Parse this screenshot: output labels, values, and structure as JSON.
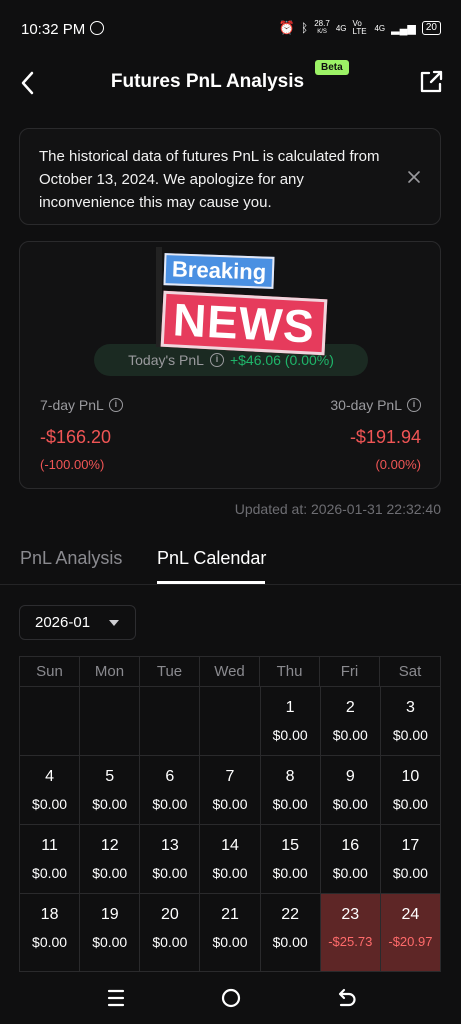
{
  "status": {
    "time": "10:32 PM",
    "speed": "28.7",
    "speed_unit": "K/S",
    "network1": "4G",
    "volte": "Vo LTE",
    "network2": "4G",
    "battery": "20"
  },
  "header": {
    "title": "Futures PnL Analysis",
    "badge": "Beta"
  },
  "notice": {
    "text": "The historical data of futures PnL is calculated from October 13, 2024. We apologize for any inconvenience this may cause you."
  },
  "overlay": {
    "breaking": "Breaking",
    "news": "NEWS"
  },
  "summary": {
    "today_label": "Today's PnL",
    "today_value": "+$46.06 (0.00%)",
    "week_label": "7-day PnL",
    "week_value": "-$166.20",
    "week_pct": "(-100.00%)",
    "month_label": "30-day PnL",
    "month_value": "-$191.94",
    "month_pct": "(0.00%)"
  },
  "updated": "Updated at: 2026-01-31 22:32:40",
  "tabs": {
    "analysis": "PnL Analysis",
    "calendar": "PnL Calendar"
  },
  "month_select": {
    "value": "2026-01"
  },
  "calendar": {
    "weekdays": [
      "Sun",
      "Mon",
      "Tue",
      "Wed",
      "Thu",
      "Fri",
      "Sat"
    ],
    "weeks": [
      [
        null,
        null,
        null,
        null,
        {
          "day": "1",
          "pnl": "$0.00"
        },
        {
          "day": "2",
          "pnl": "$0.00"
        },
        {
          "day": "3",
          "pnl": "$0.00"
        }
      ],
      [
        {
          "day": "4",
          "pnl": "$0.00"
        },
        {
          "day": "5",
          "pnl": "$0.00"
        },
        {
          "day": "6",
          "pnl": "$0.00"
        },
        {
          "day": "7",
          "pnl": "$0.00"
        },
        {
          "day": "8",
          "pnl": "$0.00"
        },
        {
          "day": "9",
          "pnl": "$0.00"
        },
        {
          "day": "10",
          "pnl": "$0.00"
        }
      ],
      [
        {
          "day": "11",
          "pnl": "$0.00"
        },
        {
          "day": "12",
          "pnl": "$0.00"
        },
        {
          "day": "13",
          "pnl": "$0.00"
        },
        {
          "day": "14",
          "pnl": "$0.00"
        },
        {
          "day": "15",
          "pnl": "$0.00"
        },
        {
          "day": "16",
          "pnl": "$0.00"
        },
        {
          "day": "17",
          "pnl": "$0.00"
        }
      ],
      [
        {
          "day": "18",
          "pnl": "$0.00"
        },
        {
          "day": "19",
          "pnl": "$0.00"
        },
        {
          "day": "20",
          "pnl": "$0.00"
        },
        {
          "day": "21",
          "pnl": "$0.00"
        },
        {
          "day": "22",
          "pnl": "$0.00"
        },
        {
          "day": "23",
          "pnl": "-$25.73",
          "negative": true
        },
        {
          "day": "24",
          "pnl": "-$20.97",
          "negative": true
        }
      ]
    ]
  },
  "colors": {
    "negative": "#f05555",
    "positive": "#1fb56a",
    "negative_cell": "#5e2626",
    "beta": "#9cf266"
  }
}
